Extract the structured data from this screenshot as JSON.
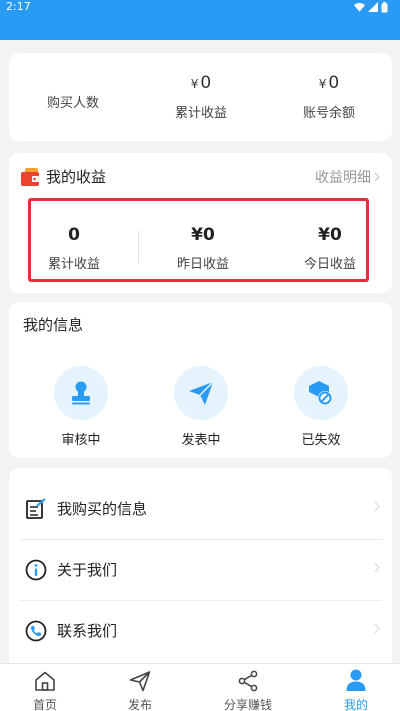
{
  "status": {
    "time": "2:17"
  },
  "stats": {
    "buyers_label": "购买人数",
    "yen": "¥",
    "total_value": "0",
    "total_label": "累计收益",
    "balance_value": "0",
    "balance_label": "账号余额"
  },
  "earnings": {
    "title": "我的收益",
    "detail_link": "收益明细",
    "total_value": "0",
    "total_label": "累计收益",
    "yesterday_value": "¥0",
    "yesterday_label": "昨日收益",
    "today_value": "¥0",
    "today_label": "今日收益",
    "highlight_color": "#e3303b"
  },
  "info": {
    "title": "我的信息",
    "items": [
      {
        "label": "审核中",
        "icon": "stamp-icon"
      },
      {
        "label": "发表中",
        "icon": "paper-plane-icon"
      },
      {
        "label": "已失效",
        "icon": "invalid-icon"
      }
    ]
  },
  "menu": {
    "items": [
      {
        "label": "我购买的信息",
        "icon": "checklist-icon"
      },
      {
        "label": "关于我们",
        "icon": "info-icon"
      },
      {
        "label": "联系我们",
        "icon": "phone-icon"
      }
    ]
  },
  "tabs": [
    {
      "label": "首页",
      "icon": "home-icon"
    },
    {
      "label": "发布",
      "icon": "send-icon"
    },
    {
      "label": "分享赚钱",
      "icon": "share-icon"
    },
    {
      "label": "我的",
      "icon": "user-icon",
      "active": true
    }
  ],
  "theme": {
    "accent": "#2a9bf5",
    "icon_bg": "#e5f3fd"
  }
}
